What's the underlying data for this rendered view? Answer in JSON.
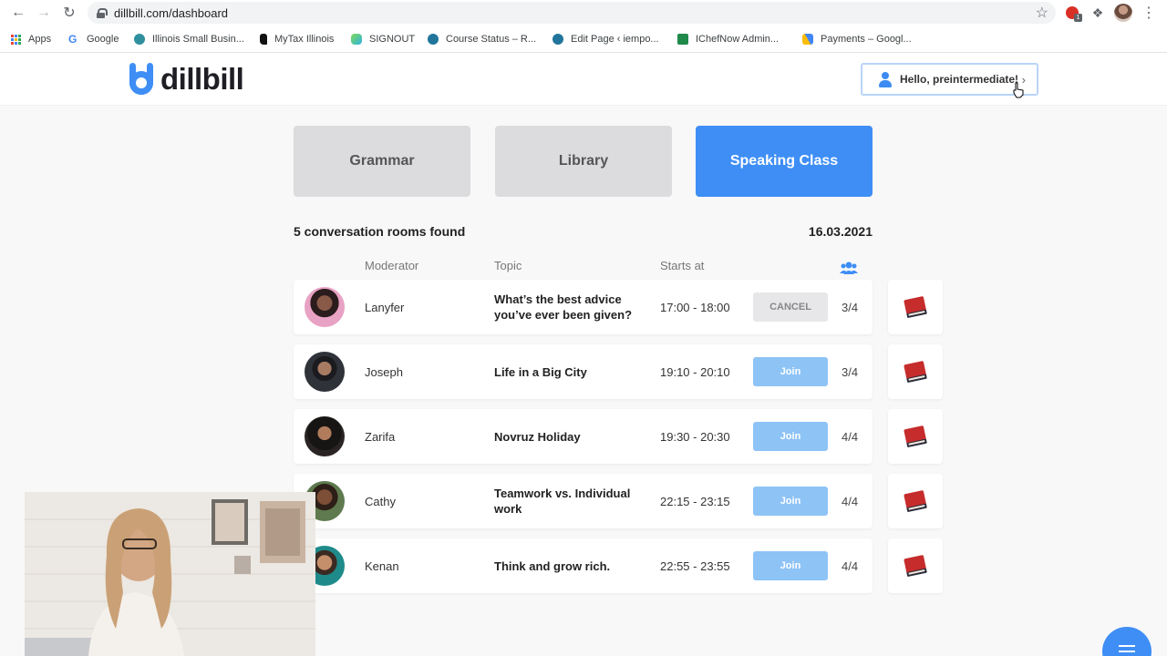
{
  "browser": {
    "url": "dillbill.com/dashboard",
    "bookmarks": [
      {
        "label": "Apps",
        "icon": "apps-grid-icon"
      },
      {
        "label": "Google",
        "icon": "google-icon"
      },
      {
        "label": "Illinois Small Busin...",
        "icon": "globe-icon"
      },
      {
        "label": "MyTax Illinois",
        "icon": "illinois-icon"
      },
      {
        "label": "SIGNOUT",
        "icon": "colorful-icon"
      },
      {
        "label": "Course Status – R...",
        "icon": "wordpress-icon"
      },
      {
        "label": "Edit Page ‹ iempo...",
        "icon": "wordpress-icon"
      },
      {
        "label": "IChefNow Admin...",
        "icon": "ichef-icon"
      },
      {
        "label": "Payments – Googl...",
        "icon": "google-ads-icon"
      }
    ]
  },
  "site": {
    "logo_text": "dillbill",
    "greeting": "Hello, preintermediate!"
  },
  "tabs": {
    "grammar": "Grammar",
    "library": "Library",
    "speaking": "Speaking Class"
  },
  "colors": {
    "accent": "#3e8ef5",
    "join_button": "#8ec3f6",
    "cancel_button": "#e7e7e9"
  },
  "rooms": {
    "found_text": "5 conversation rooms found",
    "date": "16.03.2021",
    "headers": {
      "moderator": "Moderator",
      "topic": "Topic",
      "starts_at": "Starts at"
    },
    "list": [
      {
        "moderator": "Lanyfer",
        "topic": "What’s the best advice you’ve ever been given?",
        "time": "17:00 - 18:00",
        "action": "CANCEL",
        "count": "3/4"
      },
      {
        "moderator": "Joseph",
        "topic": "Life in a Big City",
        "time": "19:10 - 20:10",
        "action": "Join",
        "count": "3/4"
      },
      {
        "moderator": "Zarifa",
        "topic": "Novruz Holiday",
        "time": "19:30 - 20:30",
        "action": "Join",
        "count": "4/4"
      },
      {
        "moderator": "Cathy",
        "topic": "Teamwork vs. Individual work",
        "time": "22:15 - 23:15",
        "action": "Join",
        "count": "4/4"
      },
      {
        "moderator": "Kenan",
        "topic": "Think and grow rich.",
        "time": "22:55 - 23:55",
        "action": "Join",
        "count": "4/4"
      }
    ]
  }
}
